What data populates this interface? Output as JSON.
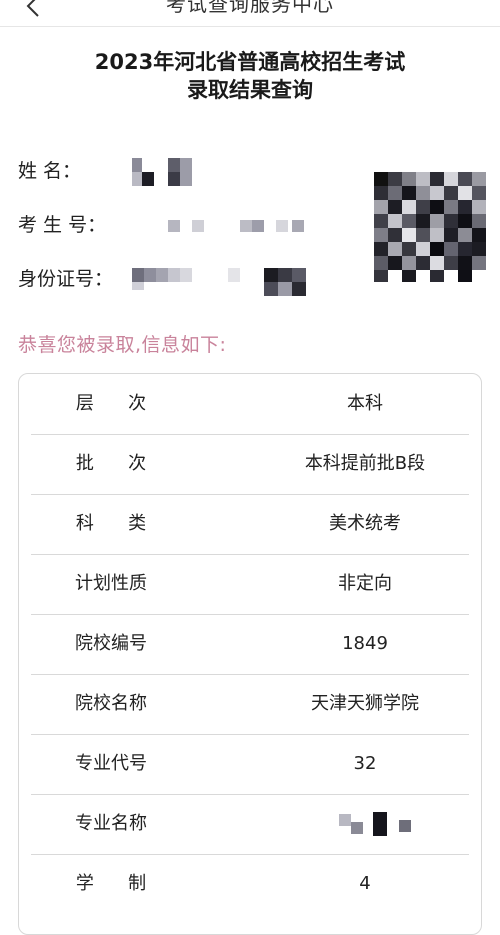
{
  "nav": {
    "title": "考试查询服务中心"
  },
  "heading": {
    "line1": "2023年河北省普通高校招生考试",
    "line2": "录取结果查询"
  },
  "info": {
    "name_label": "姓      名：",
    "exam_label": "考 生 号：",
    "id_label": "身份证号："
  },
  "congrats": "恭喜您被录取,信息如下:",
  "rows": [
    {
      "label": "层      次",
      "value": "本科"
    },
    {
      "label": "批      次",
      "value": "本科提前批B段"
    },
    {
      "label": "科      类",
      "value": "美术统考"
    },
    {
      "label": "计划性质",
      "value": "非定向"
    },
    {
      "label": "院校编号",
      "value": "1849"
    },
    {
      "label": "院校名称",
      "value": "天津天狮学院"
    },
    {
      "label": "专业代号",
      "value": "32"
    },
    {
      "label": "专业名称",
      "value": ""
    },
    {
      "label": "学      制",
      "value": "4"
    }
  ],
  "colors": {
    "accent_pink": "#c9839b",
    "border": "#d9d9d9"
  },
  "icons": {
    "back": "back-arrow-icon"
  }
}
